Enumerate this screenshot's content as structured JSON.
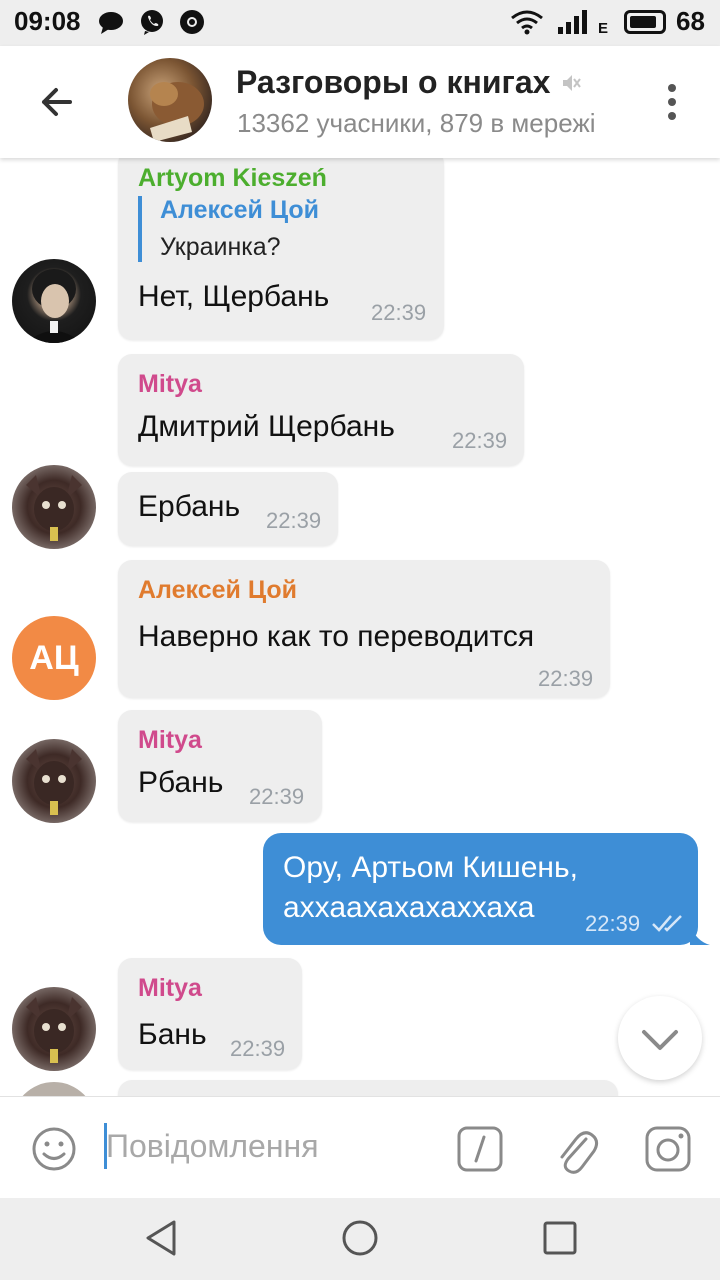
{
  "status_bar": {
    "time": "09:08",
    "network_type": "E",
    "battery_level": "68"
  },
  "header": {
    "title": "Разговоры о книгах",
    "subtitle": "13362 учасники, 879 в мережі"
  },
  "messages": [
    {
      "sender": "Artyom Kieszeń",
      "sender_color": "#4cae2e",
      "reply_to_name": "Алексей Цой",
      "reply_to_text": "Украинка?",
      "text": "Нет, Щербань",
      "time": "22:39"
    },
    {
      "sender": "Mitya",
      "sender_color": "#d04a8c",
      "text": "Дмитрий Щербань",
      "time": "22:39"
    },
    {
      "text": "Ербань",
      "time": "22:39"
    },
    {
      "sender": "Алексей Цой",
      "sender_color": "#e07b2e",
      "avatar_initials": "АЦ",
      "text": "Наверно как то переводится",
      "time": "22:39"
    },
    {
      "sender": "Mitya",
      "sender_color": "#d04a8c",
      "text": "Рбань",
      "time": "22:39"
    },
    {
      "outgoing": true,
      "text_line1": "Ору, Артьом Кишень,",
      "text_line2": "аххаахахахаххаха",
      "time": "22:39",
      "status": "read"
    },
    {
      "sender": "Mitya",
      "sender_color": "#d04a8c",
      "text": "Бань",
      "time": "22:39"
    }
  ],
  "input": {
    "placeholder": "Повідомлення",
    "value": ""
  },
  "icons": {
    "back": "arrow-left-icon",
    "mute": "muted-speaker-icon",
    "menu": "more-vertical-icon",
    "scroll_down": "chevron-down-icon",
    "emoji": "emoji-icon",
    "commands": "slash-command-icon",
    "attach": "paperclip-icon",
    "camera": "camera-icon"
  },
  "colors": {
    "accent": "#3e8ed6",
    "incoming_bubble": "#eeeeee",
    "outgoing_bubble": "#3e8ed6",
    "initials_avatar": "#f28a45"
  }
}
